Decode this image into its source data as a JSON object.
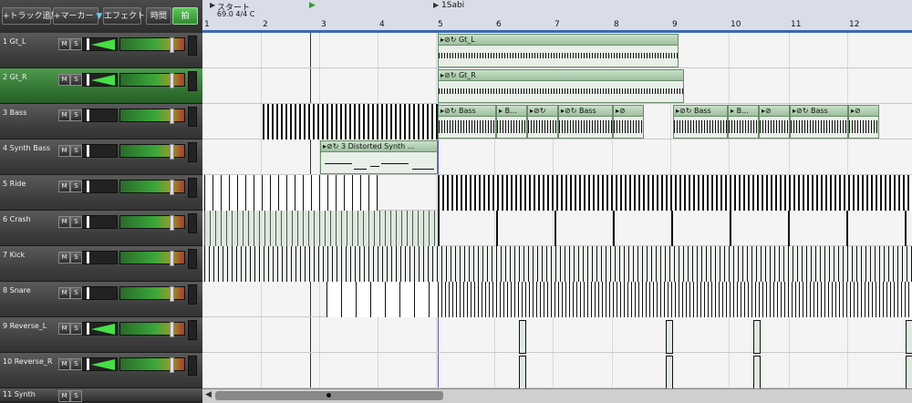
{
  "toolbar": {
    "add_track": "+トラック追加",
    "add_marker": "+マーカー",
    "effects": "エフェクト",
    "time": "時間",
    "beat": "拍"
  },
  "ruler": {
    "marker_start": "スタート",
    "marker_sabi": "1Sabi",
    "tempo_info": "69.0 4/4 C",
    "bars": [
      "1",
      "2",
      "3",
      "4",
      "5",
      "6",
      "7",
      "8",
      "9",
      "10",
      "11",
      "12"
    ]
  },
  "tracks": [
    {
      "name": "1 Gt_L"
    },
    {
      "name": "2 Gt_R"
    },
    {
      "name": "3 Bass"
    },
    {
      "name": "4 Synth Bass"
    },
    {
      "name": "5 Ride"
    },
    {
      "name": "6 Crash"
    },
    {
      "name": "7 Kick"
    },
    {
      "name": "8 Snare"
    },
    {
      "name": "9 Reverse_L"
    },
    {
      "name": "10 Reverse_R"
    },
    {
      "name": "11 Synth"
    }
  ],
  "mute_label": "M",
  "solo_label": "S",
  "clips": {
    "gt_l": "Gt_L",
    "gt_r": "Gt_R",
    "bass": "Bass",
    "bass_short": "B...",
    "synth": "3 Distorted Synth ..."
  },
  "colors": {
    "accent_green": "#3aa83a",
    "clip_header": "#9fbf9f"
  }
}
